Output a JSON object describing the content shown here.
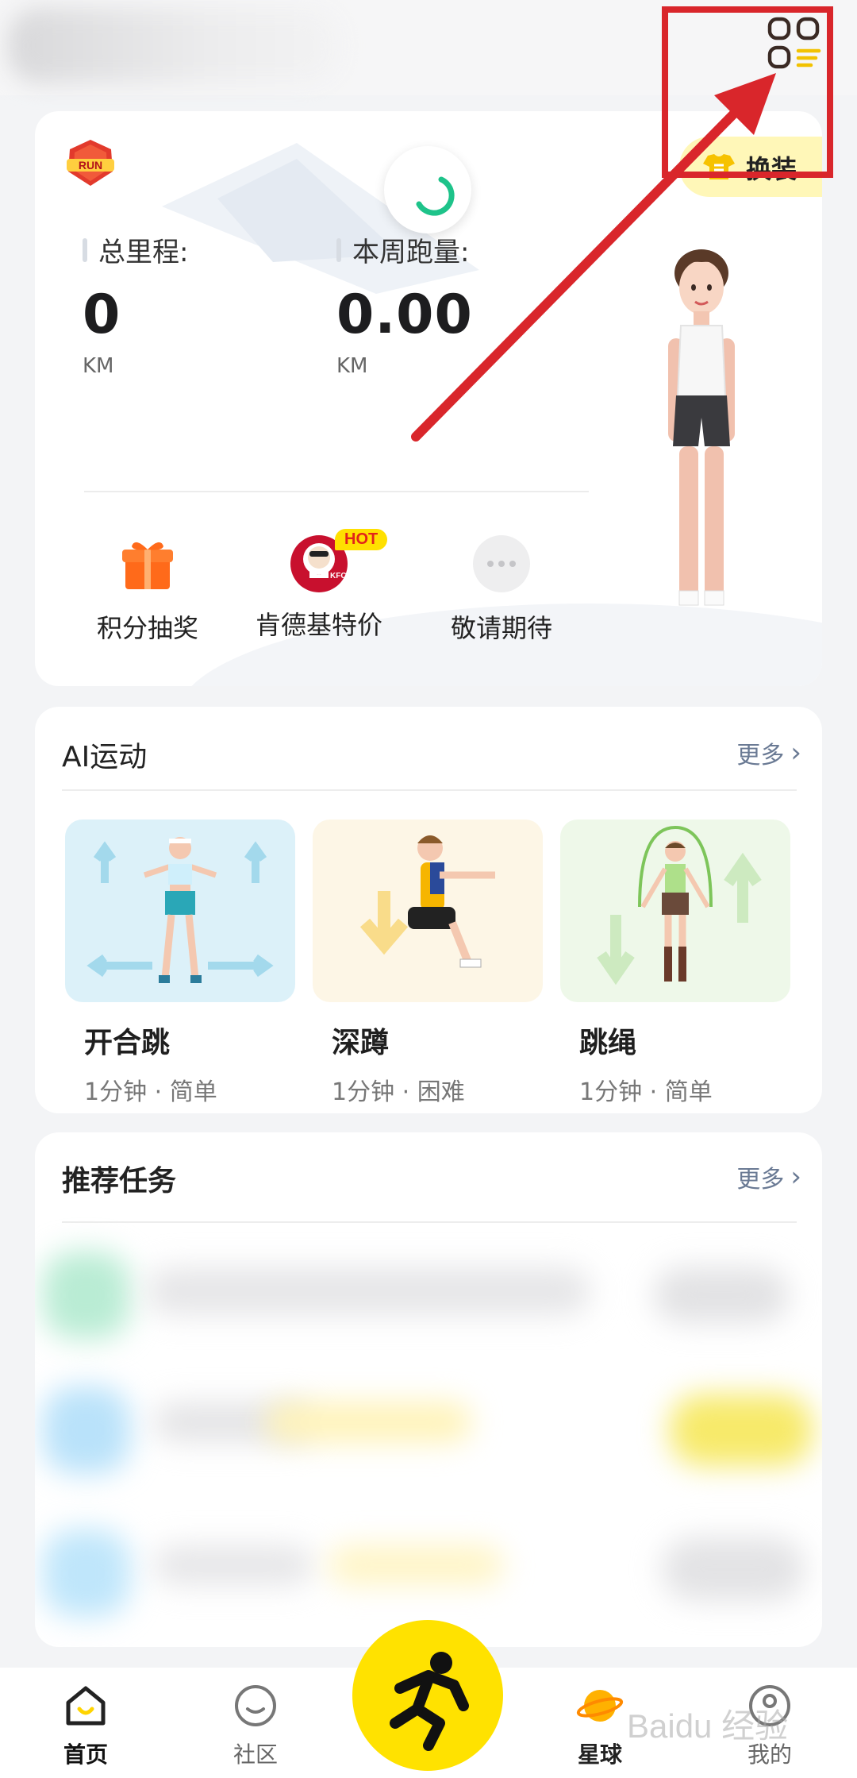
{
  "hero": {
    "run_badge": "RUN",
    "total_distance": {
      "label": "总里程:",
      "value": "0",
      "unit": "KM"
    },
    "weekly_distance": {
      "label": "本周跑量:",
      "value": "0.00",
      "unit": "KM"
    },
    "outfit_button": "换装",
    "shortcuts": [
      {
        "label": "积分抽奖",
        "icon": "gift-icon"
      },
      {
        "label": "肯德基特价",
        "icon": "kfc-icon",
        "badge": "HOT"
      },
      {
        "label": "敬请期待",
        "icon": "more-dots-icon"
      }
    ]
  },
  "ai_section": {
    "title": "AI运动",
    "more": "更多",
    "exercises": [
      {
        "name": "开合跳",
        "meta": "1分钟 · 简单"
      },
      {
        "name": "深蹲",
        "meta": "1分钟 · 困难"
      },
      {
        "name": "跳绳",
        "meta": "1分钟 · 简单"
      }
    ]
  },
  "tasks_section": {
    "title": "推荐任务",
    "more": "更多"
  },
  "bottom_nav": [
    {
      "label": "首页",
      "icon": "home-icon",
      "active": true
    },
    {
      "label": "社区",
      "icon": "community-icon"
    },
    {
      "label": "",
      "icon": "run-icon"
    },
    {
      "label": "星球",
      "icon": "planet-icon"
    },
    {
      "label": "我的",
      "icon": "profile-icon"
    }
  ],
  "watermark": "Baidu 经验",
  "colors": {
    "accent": "#ffe200",
    "annotation": "#d9262b",
    "more_link": "#6a7a94"
  }
}
